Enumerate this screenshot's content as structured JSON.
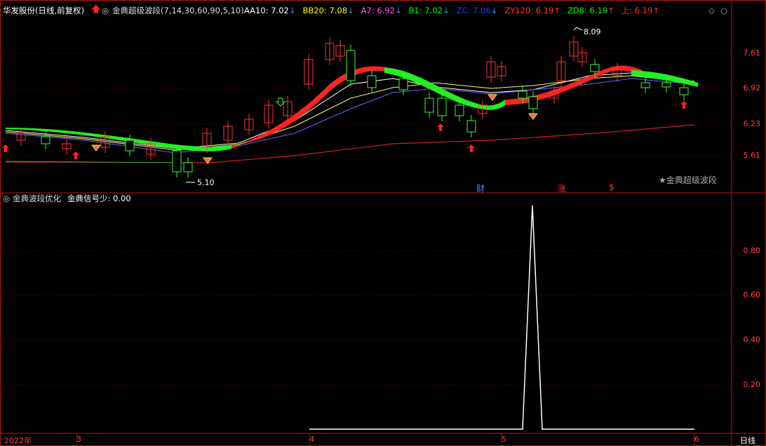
{
  "upper": {
    "stock_label": "华发股份(日线,前复权)",
    "indicator_title": "金典超级波段(7,14,30,60,90,5,10)",
    "indicators": [
      {
        "label": "AA10: 7.02",
        "arrow": "↓",
        "color": "#ffffff",
        "arrow_color": "#4488ff"
      },
      {
        "label": "BB20: 7.08",
        "arrow": "↓",
        "color": "#ffff00",
        "arrow_color": "#4488ff"
      },
      {
        "label": "A7: 6.92",
        "arrow": "↓",
        "color": "#ff55ff",
        "arrow_color": "#4488ff"
      },
      {
        "label": "B1: 7.02",
        "arrow": "↓",
        "color": "#00ff00",
        "arrow_color": "#4488ff"
      },
      {
        "label": "ZC: 7.06",
        "arrow": "↓",
        "color": "#3333ff",
        "arrow_color": "#4488ff"
      },
      {
        "label": "ZY120: 6.19",
        "arrow": "↑",
        "color": "#ff3333",
        "arrow_color": "#ff3333"
      },
      {
        "label": "ZD8: 6.19",
        "arrow": "↑",
        "color": "#00ff00",
        "arrow_color": "#ff3333"
      },
      {
        "label": "上: 6.19",
        "arrow": "↑",
        "color": "#ff3333",
        "arrow_color": "#ff3333"
      }
    ],
    "high_label": "8.09",
    "low_label": "5.10",
    "watermark_caption": "★金典超级波段",
    "y_ticks": [
      "7.61",
      "6.92",
      "6.23",
      "5.61"
    ],
    "markers": {
      "cai": "财",
      "zhang": "涨",
      "dollar": "$"
    }
  },
  "lower": {
    "indicator_title": "金典波段优化",
    "signal_label": "金典信号少: 0.00",
    "y_ticks": [
      "0.80",
      "0.60",
      "0.40",
      "0.20"
    ]
  },
  "x_axis": {
    "labels": [
      "2022年",
      "3",
      "4",
      "5",
      "6"
    ],
    "period": "日线"
  },
  "chart_data": {
    "type": "line",
    "title": "金典波段优化",
    "series": [
      {
        "name": "金典信号少",
        "x": [
          0,
          1,
          2,
          3,
          4,
          5,
          6,
          7,
          8,
          9
        ],
        "values": [
          0,
          0,
          0,
          0,
          0,
          1,
          0,
          0,
          0,
          0
        ]
      }
    ],
    "ylim": [
      0,
      1
    ],
    "colors": {
      "signal": "#ffffff",
      "grid": "#8b0000",
      "axis": "#ff4040"
    }
  }
}
